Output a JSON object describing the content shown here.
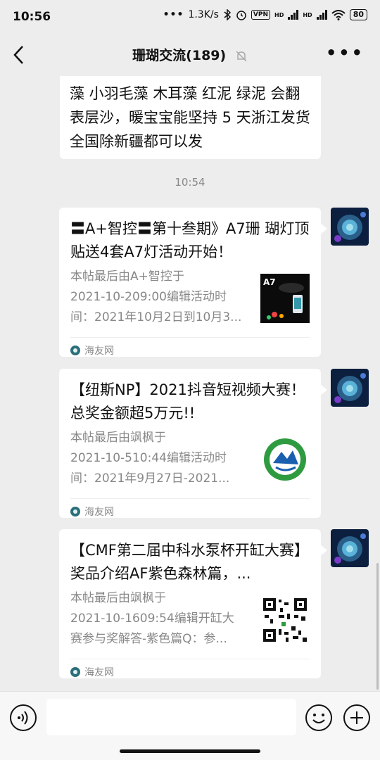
{
  "status_bar": {
    "time": "10:56",
    "speed": "1.3K/s",
    "vpn": "VPN",
    "hd1": "HD",
    "hd2": "HD",
    "battery": "80"
  },
  "header": {
    "title": "珊瑚交流(189)"
  },
  "messages": {
    "text_bubble": "藻 小羽毛藻 木耳藻 红泥 绿泥 会翻表层沙，暖宝宝能坚持 5 天浙江发货全国除新疆都可以发",
    "timestamp": "10:54"
  },
  "cards": [
    {
      "title": "〓A+智控〓第十叁期》A7珊 瑚灯顶贴送4套A7灯活动开始！",
      "desc": [
        "本帖最后由A+智控于",
        "2021-10-209:00编辑活动时",
        "间：2021年10月2日到10月3..."
      ],
      "source": "海友网",
      "thumb_label": "A7"
    },
    {
      "title": "【纽斯NP】2021抖音短视频大赛！总奖金额超5万元!!",
      "desc": [
        "本帖最后由飒枫于",
        "2021-10-510:44编辑活动时",
        "间：2021年9月27日-2021..."
      ],
      "source": "海友网"
    },
    {
      "title": "【CMF第二届中科水泵杯开缸大赛】奖品介绍AF紫色森林篇，...",
      "desc": [
        "本帖最后由飒枫于",
        "2021-10-1609:54编辑开缸大",
        "赛参与奖解答-紫色篇Q：参..."
      ],
      "source": "海友网"
    }
  ],
  "icons": {
    "back": "back-arrow-icon",
    "mute": "mute-bell-icon",
    "more": "more-dots-icon",
    "voice": "voice-icon",
    "emoji": "emoji-icon",
    "plus": "plus-icon"
  },
  "colors": {
    "background": "#ededed",
    "bubble": "#ffffff",
    "secondary_text": "#888888",
    "source_icon": "#2b6f7a"
  }
}
